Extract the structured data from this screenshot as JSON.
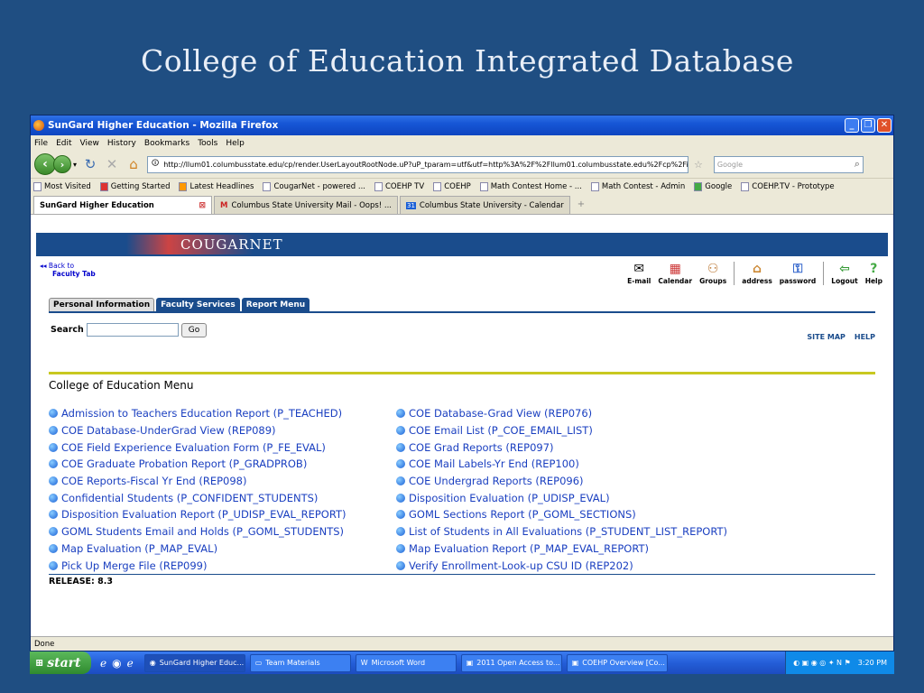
{
  "slide": {
    "title": "College of Education Integrated Database"
  },
  "window": {
    "title": "SunGard Higher Education - Mozilla Firefox"
  },
  "menubar": [
    "File",
    "Edit",
    "View",
    "History",
    "Bookmarks",
    "Tools",
    "Help"
  ],
  "nav": {
    "url": "http://llum01.columbusstate.edu/cp/render.UserLayoutRootNode.uP?uP_tparam=utf&utf=http%3A%2F%2Fllum01.columbusstate.edu%2Fcp%2Fip%2Flc",
    "search_placeholder": "Google"
  },
  "bookmarks": [
    "Most Visited",
    "Getting Started",
    "Latest Headlines",
    "CougarNet - powered ...",
    "COEHP TV",
    "COEHP",
    "Math Contest Home - ...",
    "Math Contest - Admin",
    "Google",
    "COEHP.TV - Prototype"
  ],
  "tabs": [
    "SunGard Higher Education",
    "Columbus State University Mail - Oops! ...",
    "Columbus State University - Calendar"
  ],
  "portal": {
    "logo": "COUGARNET",
    "back_line1": "Back to",
    "back_line2": "Faculty Tab",
    "icons": [
      "E-mail",
      "Calendar",
      "Groups",
      "address",
      "password",
      "Logout",
      "Help"
    ],
    "tabs": [
      "Personal Information",
      "Faculty Services",
      "Report Menu"
    ],
    "search_label": "Search",
    "search_button": "Go",
    "site_map": "SITE MAP",
    "help": "HELP",
    "menu_title": "College of Education Menu",
    "menu_left": [
      "Admission to Teachers Education Report (P_TEACHED)",
      "COE Database-UnderGrad View (REP089)",
      "COE Field Experience Evaluation Form (P_FE_EVAL)",
      "COE Graduate Probation Report (P_GRADPROB)",
      "COE Reports-Fiscal Yr End (REP098)",
      "Confidential Students (P_CONFIDENT_STUDENTS)",
      "Disposition Evaluation Report (P_UDISP_EVAL_REPORT)",
      "GOML Students Email and Holds (P_GOML_STUDENTS)",
      "Map Evaluation (P_MAP_EVAL)",
      "Pick Up Merge File (REP099)"
    ],
    "menu_right": [
      "COE Database-Grad View (REP076)",
      "COE Email List (P_COE_EMAIL_LIST)",
      "COE Grad Reports (REP097)",
      "COE Mail Labels-Yr End (REP100)",
      "COE Undergrad Reports (REP096)",
      "Disposition Evaluation (P_UDISP_EVAL)",
      "GOML Sections Report (P_GOML_SECTIONS)",
      "List of Students in All Evaluations (P_STUDENT_LIST_REPORT)",
      "Map Evaluation Report (P_MAP_EVAL_REPORT)",
      "Verify Enrollment-Look-up CSU ID (REP202)"
    ],
    "release": "RELEASE: 8.3"
  },
  "status": "Done",
  "taskbar": {
    "start": "start",
    "tasks": [
      "SunGard Higher Educ...",
      "Team Materials",
      "Microsoft Word",
      "2011 Open Access to...",
      "COEHP Overview [Co..."
    ],
    "clock": "3:20 PM"
  }
}
